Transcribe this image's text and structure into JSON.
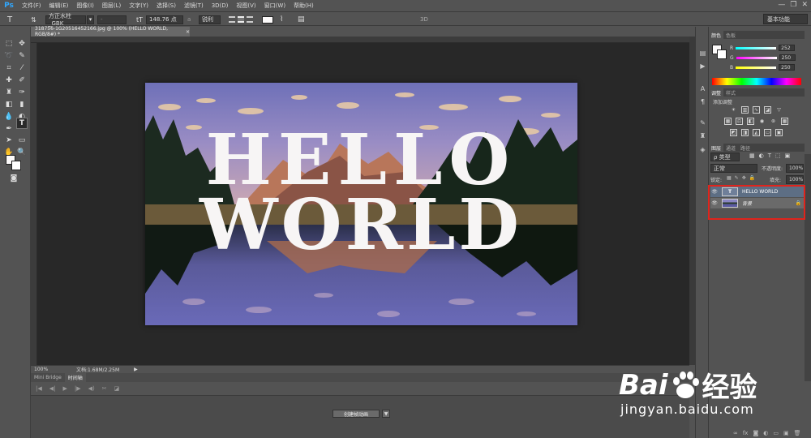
{
  "app": {
    "logo": "Ps"
  },
  "menu": [
    "文件(F)",
    "编辑(E)",
    "图像(I)",
    "图层(L)",
    "文字(Y)",
    "选择(S)",
    "滤镜(T)",
    "3D(D)",
    "视图(V)",
    "窗口(W)",
    "帮助(H)"
  ],
  "window_buttons": [
    "—",
    "❐",
    "✕"
  ],
  "options": {
    "font_family": "方正水柱_GBK",
    "font_style": "-",
    "font_size": "148.76 点",
    "aa_label": "a",
    "aa_mode": "锐利",
    "mode_3d": "3D",
    "workspace": "基本功能"
  },
  "document": {
    "tab_title": "318756-1G20516452166.jpg @ 100% (HELLO WORLD, RGB/8#) *",
    "close": "×",
    "text_line1": "HELLO",
    "text_line2": "WORLD"
  },
  "status": {
    "zoom": "100%",
    "doc_info": "文档:1.68M/2.25M",
    "arrow": "▶"
  },
  "timeline": {
    "tabs": [
      "Mini Bridge",
      "时间轴"
    ],
    "create_button": "创建帧动画",
    "arrow": "▼"
  },
  "color_panel": {
    "tabs": [
      "颜色",
      "色板"
    ],
    "r_label": "R",
    "r_value": "252",
    "g_label": "G",
    "g_value": "250",
    "b_label": "B",
    "b_value": "250"
  },
  "adjust_panel": {
    "tabs": [
      "调整",
      "样式"
    ],
    "title": "添加调整"
  },
  "layers_panel": {
    "tabs": [
      "图层",
      "通道",
      "路径"
    ],
    "filter": "ρ 类型",
    "blend_mode": "正常",
    "opacity_label": "不透明度:",
    "opacity_value": "100%",
    "lock_label": "锁定:",
    "fill_label": "填充:",
    "fill_value": "100%",
    "layers": [
      {
        "name": "HELLO WORLD",
        "thumb": "T"
      },
      {
        "name": "背景",
        "lock": "🔒"
      }
    ]
  },
  "watermark": {
    "brand_left": "Bai",
    "brand_right": "经验",
    "url": "jingyan.baidu.com"
  },
  "colors": {
    "ui_bg": "#535353",
    "canvas_bg": "#282828",
    "selection_highlight": "#e0241c",
    "layer_selected": "#5d6e84"
  }
}
